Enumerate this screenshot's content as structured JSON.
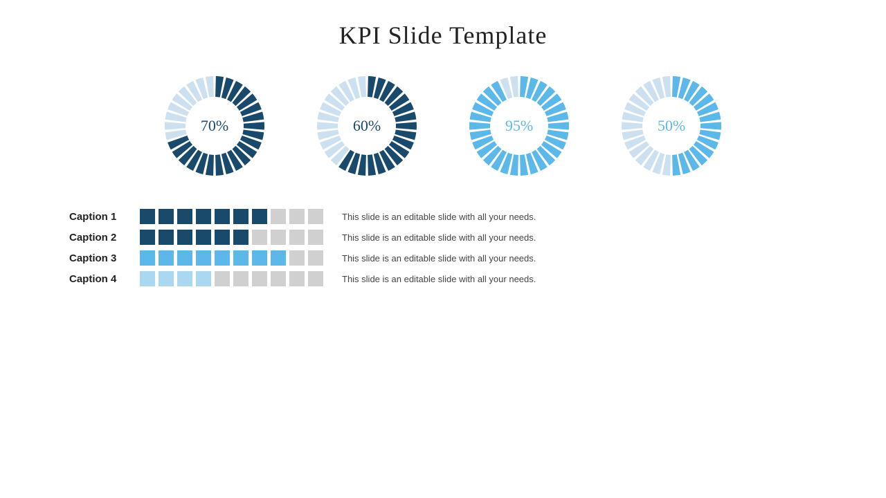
{
  "title": "KPI Slide Template",
  "charts": [
    {
      "id": "chart1",
      "value": 70,
      "label": "70%",
      "color_filled": "#1a4a6b",
      "color_empty": "#cce0f0",
      "label_color": "#1a4a6b",
      "total_segments": 30,
      "filled_segments": 21
    },
    {
      "id": "chart2",
      "value": 60,
      "label": "60%",
      "color_filled": "#1a4a6b",
      "color_empty": "#cce0f0",
      "label_color": "#1a4a6b",
      "total_segments": 30,
      "filled_segments": 18
    },
    {
      "id": "chart3",
      "value": 95,
      "label": "95%",
      "color_filled": "#5bb8e8",
      "color_empty": "#cce0f0",
      "label_color": "#5bb8e8",
      "total_segments": 30,
      "filled_segments": 28
    },
    {
      "id": "chart4",
      "value": 50,
      "label": "50%",
      "color_filled": "#5bb8e8",
      "color_empty": "#cce0f0",
      "label_color": "#5bb8e8",
      "total_segments": 30,
      "filled_segments": 15
    }
  ],
  "captions": [
    {
      "label": "Caption 1",
      "filled": 7,
      "total": 10,
      "color_filled": "#1a4a6b",
      "color_empty": "#d0d0d0",
      "description": "This slide is an editable slide with all your needs."
    },
    {
      "label": "Caption 2",
      "filled": 6,
      "total": 10,
      "color_filled": "#1a4a6b",
      "color_empty": "#d0d0d0",
      "description": "This slide is an editable slide with all your needs."
    },
    {
      "label": "Caption 3",
      "filled": 8,
      "total": 10,
      "color_filled": "#5bb8e8",
      "color_empty": "#d0d0d0",
      "description": "This slide is an editable slide with all your needs."
    },
    {
      "label": "Caption 4",
      "filled": 4,
      "total": 10,
      "color_filled": "#aad8f0",
      "color_empty": "#d0d0d0",
      "description": "This slide is an editable slide with all your needs."
    }
  ]
}
